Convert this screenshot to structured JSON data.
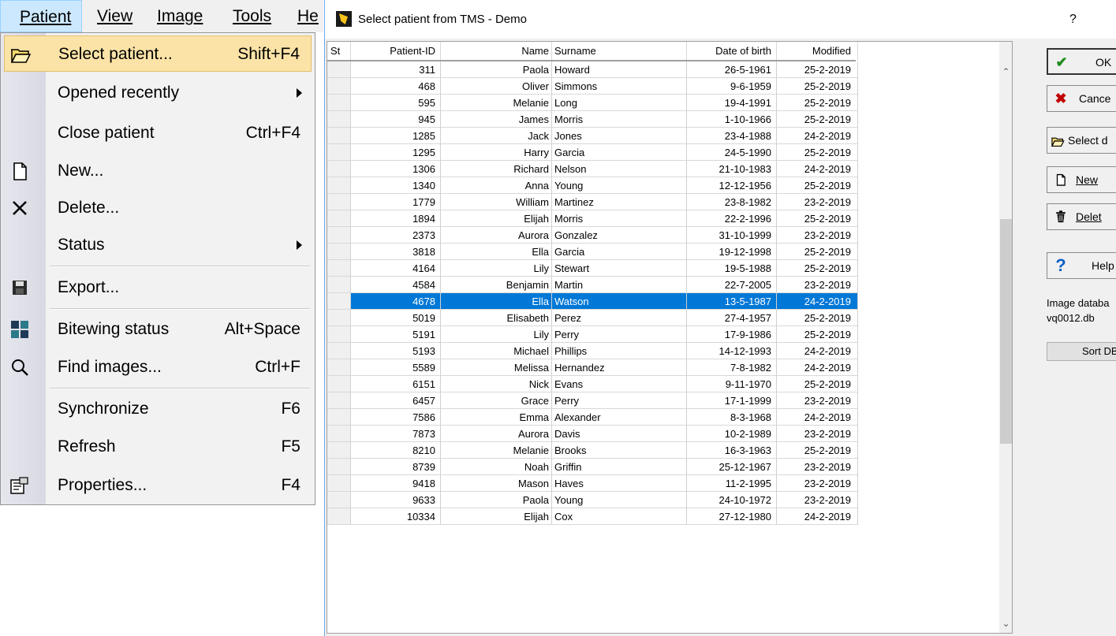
{
  "menubar": [
    {
      "label": "Patient",
      "active": true
    },
    {
      "label": "View"
    },
    {
      "label": "Image"
    },
    {
      "label": "Tools"
    },
    {
      "label": "He"
    }
  ],
  "menu": {
    "items": [
      {
        "label": "Select patient...",
        "shortcut": "Shift+F4",
        "icon": "open-folder-icon",
        "highlighted": true
      },
      {
        "label": "Opened recently",
        "submenu": true
      },
      {
        "label": "Close patient",
        "shortcut": "Ctrl+F4"
      },
      {
        "label": "New...",
        "icon": "new-document-icon"
      },
      {
        "label": "Delete...",
        "icon": "delete-x-icon"
      },
      {
        "label": "Status",
        "submenu": true
      },
      {
        "label": "Export...",
        "icon": "save-disk-icon"
      },
      {
        "label": "Bitewing status",
        "shortcut": "Alt+Space",
        "icon": "bitewing-grid-icon"
      },
      {
        "label": "Find images...",
        "shortcut": "Ctrl+F",
        "icon": "magnifier-icon"
      },
      {
        "label": "Synchronize",
        "shortcut": "F6"
      },
      {
        "label": "Refresh",
        "shortcut": "F5"
      },
      {
        "label": "Properties...",
        "shortcut": "F4",
        "icon": "properties-icon"
      }
    ]
  },
  "dialog": {
    "title": "Select patient from TMS - Demo",
    "help": "?",
    "columns": {
      "st": "St",
      "id": "Patient-ID",
      "name": "Name",
      "surname": "Surname",
      "dob": "Date of birth",
      "modified": "Modified"
    },
    "rows": [
      {
        "id": "311",
        "name": "Paola",
        "surname": "Howard",
        "dob": "26-5-1961",
        "modified": "25-2-2019"
      },
      {
        "id": "468",
        "name": "Oliver",
        "surname": "Simmons",
        "dob": "9-6-1959",
        "modified": "25-2-2019"
      },
      {
        "id": "595",
        "name": "Melanie",
        "surname": "Long",
        "dob": "19-4-1991",
        "modified": "25-2-2019"
      },
      {
        "id": "945",
        "name": "James",
        "surname": "Morris",
        "dob": "1-10-1966",
        "modified": "25-2-2019"
      },
      {
        "id": "1285",
        "name": "Jack",
        "surname": "Jones",
        "dob": "23-4-1988",
        "modified": "24-2-2019"
      },
      {
        "id": "1295",
        "name": "Harry",
        "surname": "Garcia",
        "dob": "24-5-1990",
        "modified": "25-2-2019"
      },
      {
        "id": "1306",
        "name": "Richard",
        "surname": "Nelson",
        "dob": "21-10-1983",
        "modified": "24-2-2019"
      },
      {
        "id": "1340",
        "name": "Anna",
        "surname": "Young",
        "dob": "12-12-1956",
        "modified": "25-2-2019"
      },
      {
        "id": "1779",
        "name": "William",
        "surname": "Martinez",
        "dob": "23-8-1982",
        "modified": "23-2-2019"
      },
      {
        "id": "1894",
        "name": "Elijah",
        "surname": "Morris",
        "dob": "22-2-1996",
        "modified": "25-2-2019"
      },
      {
        "id": "2373",
        "name": "Aurora",
        "surname": "Gonzalez",
        "dob": "31-10-1999",
        "modified": "23-2-2019"
      },
      {
        "id": "3818",
        "name": "Ella",
        "surname": "Garcia",
        "dob": "19-12-1998",
        "modified": "25-2-2019"
      },
      {
        "id": "4164",
        "name": "Lily",
        "surname": "Stewart",
        "dob": "19-5-1988",
        "modified": "25-2-2019"
      },
      {
        "id": "4584",
        "name": "Benjamin",
        "surname": "Martin",
        "dob": "22-7-2005",
        "modified": "23-2-2019"
      },
      {
        "id": "4678",
        "name": "Ella",
        "surname": "Watson",
        "dob": "13-5-1987",
        "modified": "24-2-2019",
        "selected": true
      },
      {
        "id": "5019",
        "name": "Elisabeth",
        "surname": "Perez",
        "dob": "27-4-1957",
        "modified": "25-2-2019"
      },
      {
        "id": "5191",
        "name": "Lily",
        "surname": "Perry",
        "dob": "17-9-1986",
        "modified": "25-2-2019"
      },
      {
        "id": "5193",
        "name": "Michael",
        "surname": "Phillips",
        "dob": "14-12-1993",
        "modified": "24-2-2019"
      },
      {
        "id": "5589",
        "name": "Melissa",
        "surname": "Hernandez",
        "dob": "7-8-1982",
        "modified": "24-2-2019"
      },
      {
        "id": "6151",
        "name": "Nick",
        "surname": "Evans",
        "dob": "9-11-1970",
        "modified": "25-2-2019"
      },
      {
        "id": "6457",
        "name": "Grace",
        "surname": "Perry",
        "dob": "17-1-1999",
        "modified": "23-2-2019"
      },
      {
        "id": "7586",
        "name": "Emma",
        "surname": "Alexander",
        "dob": "8-3-1968",
        "modified": "24-2-2019"
      },
      {
        "id": "7873",
        "name": "Aurora",
        "surname": "Davis",
        "dob": "10-2-1989",
        "modified": "23-2-2019"
      },
      {
        "id": "8210",
        "name": "Melanie",
        "surname": "Brooks",
        "dob": "16-3-1963",
        "modified": "25-2-2019"
      },
      {
        "id": "8739",
        "name": "Noah",
        "surname": "Griffin",
        "dob": "25-12-1967",
        "modified": "23-2-2019"
      },
      {
        "id": "9418",
        "name": "Mason",
        "surname": "Haves",
        "dob": "11-2-1995",
        "modified": "23-2-2019"
      },
      {
        "id": "9633",
        "name": "Paola",
        "surname": "Young",
        "dob": "24-10-1972",
        "modified": "23-2-2019"
      },
      {
        "id": "10334",
        "name": "Elijah",
        "surname": "Cox",
        "dob": "27-12-1980",
        "modified": "24-2-2019"
      }
    ],
    "buttons": {
      "ok": "OK",
      "cancel": "Cance",
      "select": "Select d",
      "new": "New",
      "delete": "Delet",
      "help": "Help"
    },
    "db_label": "Image databa",
    "db_file": "vq0012.db",
    "sort_db": "Sort DB"
  },
  "colors": {
    "selection": "#0078d7",
    "menu_highlight": "#fbe3a7",
    "ok_check": "#1e8c1e",
    "cancel_x": "#c00000"
  }
}
